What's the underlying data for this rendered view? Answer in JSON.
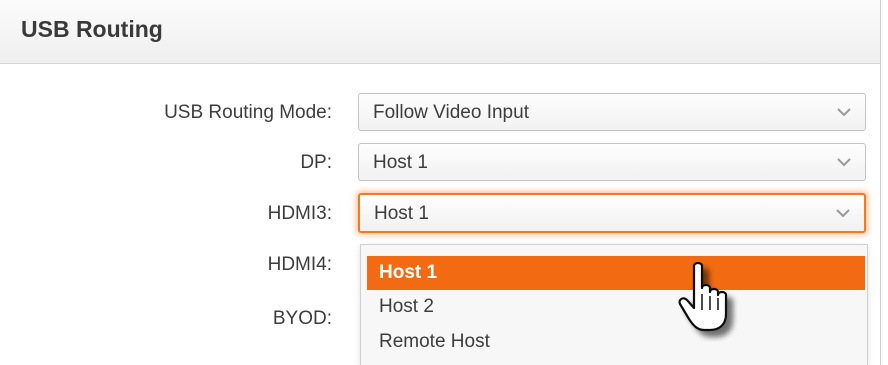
{
  "panel": {
    "title": "USB Routing"
  },
  "rows": [
    {
      "label": "USB Routing Mode:",
      "value": "Follow Video Input"
    },
    {
      "label": "DP:",
      "value": "Host 1"
    },
    {
      "label": "HDMI3:",
      "value": "Host 1"
    },
    {
      "label": "HDMI4:"
    },
    {
      "label": "BYOD:"
    }
  ],
  "dropdown": {
    "options": [
      "Host 1",
      "Host 2",
      "Remote Host"
    ],
    "selected": "Host 1"
  },
  "colors": {
    "accent": "#f26b12",
    "focus_ring": "#f47a20"
  },
  "icons": {
    "chevron": "chevron-down-icon",
    "cursor": "hand-pointer-icon"
  }
}
